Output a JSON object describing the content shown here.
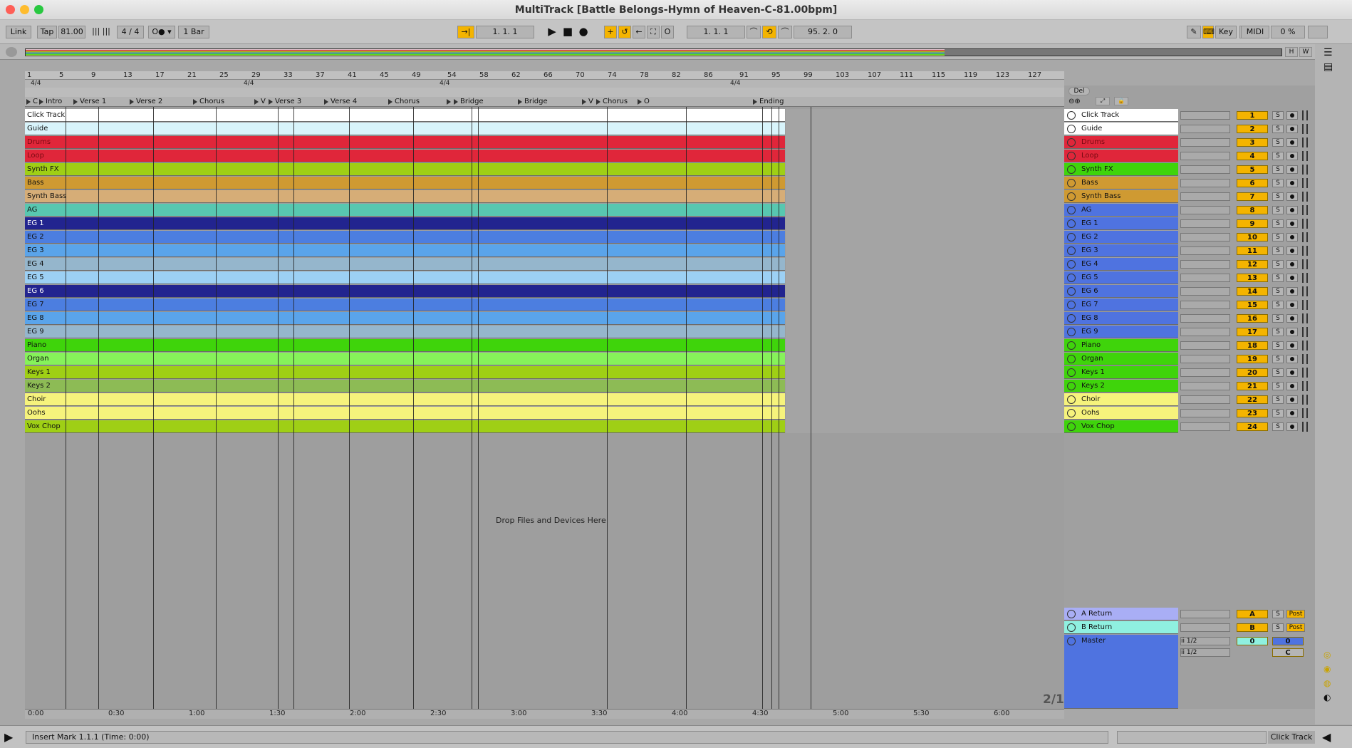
{
  "window": {
    "title": "MultiTrack  [Battle Belongs-Hymn of Heaven-C-81.00bpm]"
  },
  "transport": {
    "link": "Link",
    "tap": "Tap",
    "tempo": "81.00",
    "signature": "4 / 4",
    "quantize": "1 Bar",
    "arrangement_position": "1.   1.   1",
    "loop_start": "1.   1.   1",
    "loop_length": "95.   2.   0",
    "key_label": "Key",
    "midi_label": "MIDI",
    "cpu": "0 %"
  },
  "ruler": {
    "bars": [
      "1",
      "5",
      "9",
      "13",
      "17",
      "21",
      "25",
      "29",
      "33",
      "37",
      "41",
      "45",
      "49",
      "54",
      "58",
      "62",
      "66",
      "70",
      "74",
      "78",
      "82",
      "86",
      "91",
      "95",
      "99",
      "103",
      "107",
      "111",
      "115",
      "119",
      "123",
      "127"
    ]
  },
  "time_signatures": [
    "4/4",
    "4/4",
    "4/4",
    "4/4"
  ],
  "markers": [
    "C",
    "Intro",
    "Verse 1",
    "Verse 2",
    "Chorus",
    "V",
    "Verse 3",
    "Verse 4",
    "Chorus",
    "Bridge",
    "Bridge",
    "Bridge",
    "V",
    "Chorus",
    "O",
    "Ending"
  ],
  "drop_text": "Drop Files and Devices Here",
  "del_label": "Del",
  "timeline": [
    "0:00",
    "0:30",
    "1:00",
    "1:30",
    "2:00",
    "2:30",
    "3:00",
    "3:30",
    "4:00",
    "4:30",
    "5:00",
    "5:30",
    "6:00"
  ],
  "page_indicator": "2/1",
  "tracks": [
    {
      "name": "Click Track",
      "num": "1",
      "color": "#ffffff",
      "text": "#111"
    },
    {
      "name": "Guide",
      "num": "2",
      "color": "#d8f4fb",
      "text": "#111"
    },
    {
      "name": "Drums",
      "num": "3",
      "color": "#e0263a",
      "text": "#7a0a12"
    },
    {
      "name": "Loop",
      "num": "4",
      "color": "#e0263a",
      "text": "#7a0a12"
    },
    {
      "name": "Synth FX",
      "num": "5",
      "color": "#9fcf15",
      "text": "#111"
    },
    {
      "name": "Bass",
      "num": "6",
      "color": "#cf9a32",
      "text": "#111"
    },
    {
      "name": "Synth Bass",
      "num": "7",
      "color": "#d6ad77",
      "text": "#111"
    },
    {
      "name": "AG",
      "num": "8",
      "color": "#58c7b0",
      "text": "#111"
    },
    {
      "name": "EG 1",
      "num": "9",
      "color": "#22248f",
      "text": "#fff"
    },
    {
      "name": "EG 2",
      "num": "10",
      "color": "#4c7ee0",
      "text": "#111"
    },
    {
      "name": "EG 3",
      "num": "11",
      "color": "#5aa4ea",
      "text": "#111"
    },
    {
      "name": "EG 4",
      "num": "12",
      "color": "#95b6cc",
      "text": "#111"
    },
    {
      "name": "EG 5",
      "num": "13",
      "color": "#9cd0f4",
      "text": "#111"
    },
    {
      "name": "EG 6",
      "num": "14",
      "color": "#22248f",
      "text": "#fff"
    },
    {
      "name": "EG 7",
      "num": "15",
      "color": "#4c7ee0",
      "text": "#111"
    },
    {
      "name": "EG 8",
      "num": "16",
      "color": "#5aa4ea",
      "text": "#111"
    },
    {
      "name": "EG 9",
      "num": "17",
      "color": "#95b6cc",
      "text": "#111"
    },
    {
      "name": "Piano",
      "num": "18",
      "color": "#3fd40b",
      "text": "#111"
    },
    {
      "name": "Organ",
      "num": "19",
      "color": "#86f25a",
      "text": "#111"
    },
    {
      "name": "Keys 1",
      "num": "20",
      "color": "#9fcf15",
      "text": "#111"
    },
    {
      "name": "Keys 2",
      "num": "21",
      "color": "#8dbb55",
      "text": "#111"
    },
    {
      "name": "Choir",
      "num": "22",
      "color": "#f6f37c",
      "text": "#111"
    },
    {
      "name": "Oohs",
      "num": "23",
      "color": "#f6f37c",
      "text": "#111"
    },
    {
      "name": "Vox Chop",
      "num": "24",
      "color": "#9fcf15",
      "text": "#111"
    }
  ],
  "mixer_colors": {
    "Click Track": "#ffffff",
    "Guide": "#ffffff",
    "Drums": "#e0263a",
    "Loop": "#e0263a",
    "Synth FX": "#3fd40b",
    "Bass": "#cf9a32",
    "Synth Bass": "#cf9a32",
    "AG": "#4f73e0",
    "EG": "#4f73e0",
    "Piano": "#3fd40b",
    "Organ": "#3fd40b",
    "Keys 1": "#3fd40b",
    "Keys 2": "#3fd40b",
    "Choir": "#f6f37c",
    "Oohs": "#f6f37c",
    "Vox Chop": "#3fd40b"
  },
  "returns": [
    {
      "name": "A Return",
      "num": "A",
      "color": "#a9aef5",
      "post": "Post"
    },
    {
      "name": "B Return",
      "num": "B",
      "color": "#8ff0e0",
      "post": "Post"
    }
  ],
  "master": {
    "name": "Master",
    "color": "#4f73e0",
    "in1": "ii 1/2",
    "in2": "ii 1/2",
    "val1": "0",
    "val2": "0",
    "pan": "C"
  },
  "status": {
    "message": "Insert Mark 1.1.1 (Time: 0:00)",
    "track": "Click Track"
  }
}
